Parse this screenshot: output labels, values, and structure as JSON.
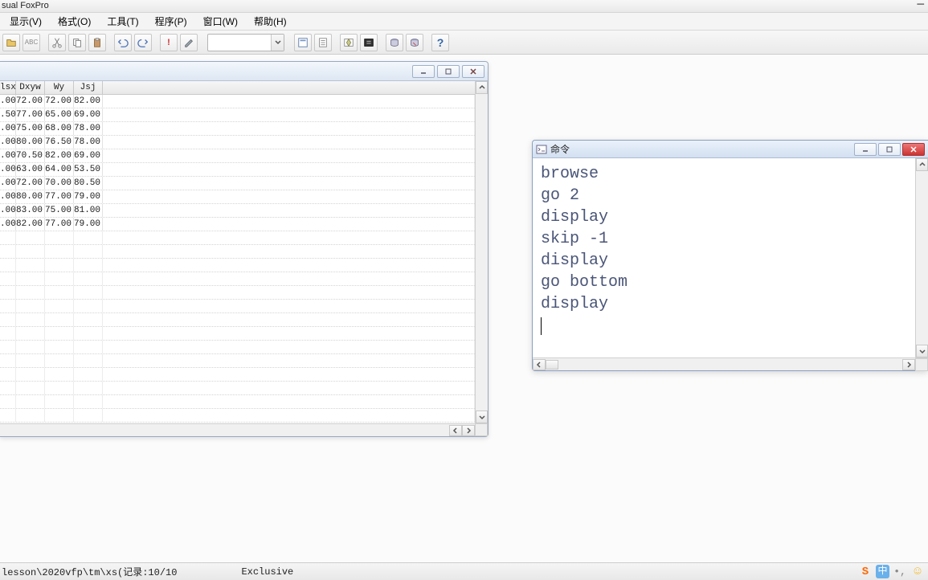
{
  "title": "sual FoxPro",
  "menu": [
    "显示(V)",
    "格式(O)",
    "工具(T)",
    "程序(P)",
    "窗口(W)",
    "帮助(H)"
  ],
  "browse": {
    "cols": [
      {
        "name": "lsx",
        "w": 20
      },
      {
        "name": "Dxyw",
        "w": 36
      },
      {
        "name": "Wy",
        "w": 36
      },
      {
        "name": "Jsj",
        "w": 36
      }
    ],
    "rows": [
      [
        ".00",
        "72.00",
        "72.00",
        "82.00"
      ],
      [
        ".50",
        "77.00",
        "65.00",
        "69.00"
      ],
      [
        ".00",
        "75.00",
        "68.00",
        "78.00"
      ],
      [
        ".00",
        "80.00",
        "76.50",
        "78.00"
      ],
      [
        ".00",
        "70.50",
        "82.00",
        "69.00"
      ],
      [
        ".00",
        "63.00",
        "64.00",
        "53.50"
      ],
      [
        ".00",
        "72.00",
        "70.00",
        "80.50"
      ],
      [
        ".00",
        "80.00",
        "77.00",
        "79.00"
      ],
      [
        ".00",
        "83.00",
        "75.00",
        "81.00"
      ],
      [
        ".00",
        "82.00",
        "77.00",
        "79.00"
      ]
    ],
    "blank_rows": 14
  },
  "command_window": {
    "title": "命令",
    "lines": [
      "browse",
      "go 2",
      "display",
      "skip -1",
      "display",
      "go bottom",
      "display"
    ]
  },
  "statusbar": {
    "left": "lesson\\2020vfp\\tm\\xs(记录:10/10",
    "mode": "Exclusive"
  },
  "tray": {
    "ime_brand": "S",
    "ime_mode": "中",
    "punct": "•,",
    "emoji": "☺"
  }
}
